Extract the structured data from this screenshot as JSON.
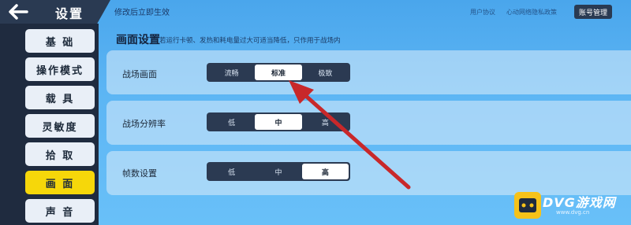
{
  "header": {
    "title": "设置",
    "notice": "修改后立即生效",
    "links": [
      "用户协议",
      "心动网络隐私政策"
    ],
    "account_button": "账号管理"
  },
  "sidebar": {
    "items": [
      {
        "label": "基 础",
        "active": false
      },
      {
        "label": "操作模式",
        "active": false
      },
      {
        "label": "载 具",
        "active": false
      },
      {
        "label": "灵敏度",
        "active": false
      },
      {
        "label": "拾 取",
        "active": false
      },
      {
        "label": "画 面",
        "active": true
      },
      {
        "label": "声 音",
        "active": false
      }
    ]
  },
  "main": {
    "section_title": "画面设置",
    "section_desc": "若运行卡顿、发热和耗电量过大可适当降低，只作用于战场内",
    "rows": [
      {
        "label": "战场画面",
        "options": [
          "流畅",
          "标准",
          "极致"
        ],
        "selected": 1
      },
      {
        "label": "战场分辨率",
        "options": [
          "低",
          "中",
          "高"
        ],
        "selected": 1
      },
      {
        "label": "帧数设置",
        "options": [
          "低",
          "中",
          "高"
        ],
        "selected": 2
      }
    ]
  },
  "watermark": {
    "brand": "DVG游戏网",
    "url": "www.dvg.cn"
  },
  "colors": {
    "accent_active": "#f6d70a",
    "sidebar_bg": "#1f2b3f",
    "arrow": "#c8282a"
  }
}
